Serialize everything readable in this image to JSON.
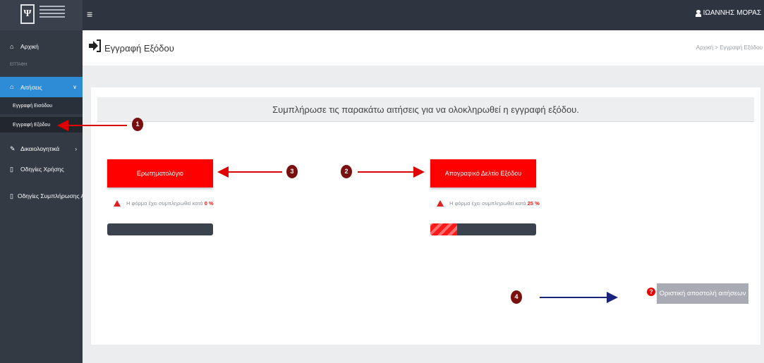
{
  "topbar": {
    "user_name": "ΙΩΑΝΝΗΣ ΜΟΡΑΣ"
  },
  "sidebar": {
    "home": "Αρχική",
    "section": "ΕΠΤΑΦΗ",
    "applications": "Αιτήσεις",
    "entry_registration": "Εγγραφή Εισόδου",
    "exit_registration": "Εγγραφή Εξόδου",
    "documents": "Δικαιολογητικά",
    "usage_guide": "Οδηγίες Χρήσης",
    "completion_guide": "Οδηγίες Συμπλήρωσης Αιτησ"
  },
  "header": {
    "title": "Εγγραφή Εξόδου",
    "breadcrumb_home": "Αρχική",
    "breadcrumb_sep": ">",
    "breadcrumb_current": "Εγγραφή Εξόδου"
  },
  "card": {
    "heading": "Συμπλήρωσε τις παρακάτω αιτήσεις για να ολοκληρωθεί η εγγραφή εξόδου."
  },
  "forms": [
    {
      "label": "Ερωτηματολόγιο",
      "status_text": "Η φόρμα έχει συμπληρωθεί κατά",
      "percent_label": "0 %",
      "progress": 0
    },
    {
      "label": "Απογραφικό Δελτίο Εξόδου",
      "status_text": "Η φόρμα έχει συμπληρωθεί κατά",
      "percent_label": "25 %",
      "progress": 0.25
    }
  ],
  "submit": {
    "label": "Οριστική αποστολή αιτήσεων",
    "help": "?"
  },
  "annotations": {
    "m1": "1",
    "m2": "2",
    "m3": "3",
    "m4": "4"
  },
  "colors": {
    "accent": "#ff0000",
    "sidebar": "#333a44",
    "active": "#2e8bd6",
    "arrow_red": "#e00000",
    "arrow_navy": "#1a237e"
  },
  "icons": [
    "user-icon",
    "menu-icon",
    "home-icon",
    "bank-icon",
    "document-icon",
    "file-icon",
    "sign-out-icon",
    "warning-icon",
    "help-icon"
  ]
}
